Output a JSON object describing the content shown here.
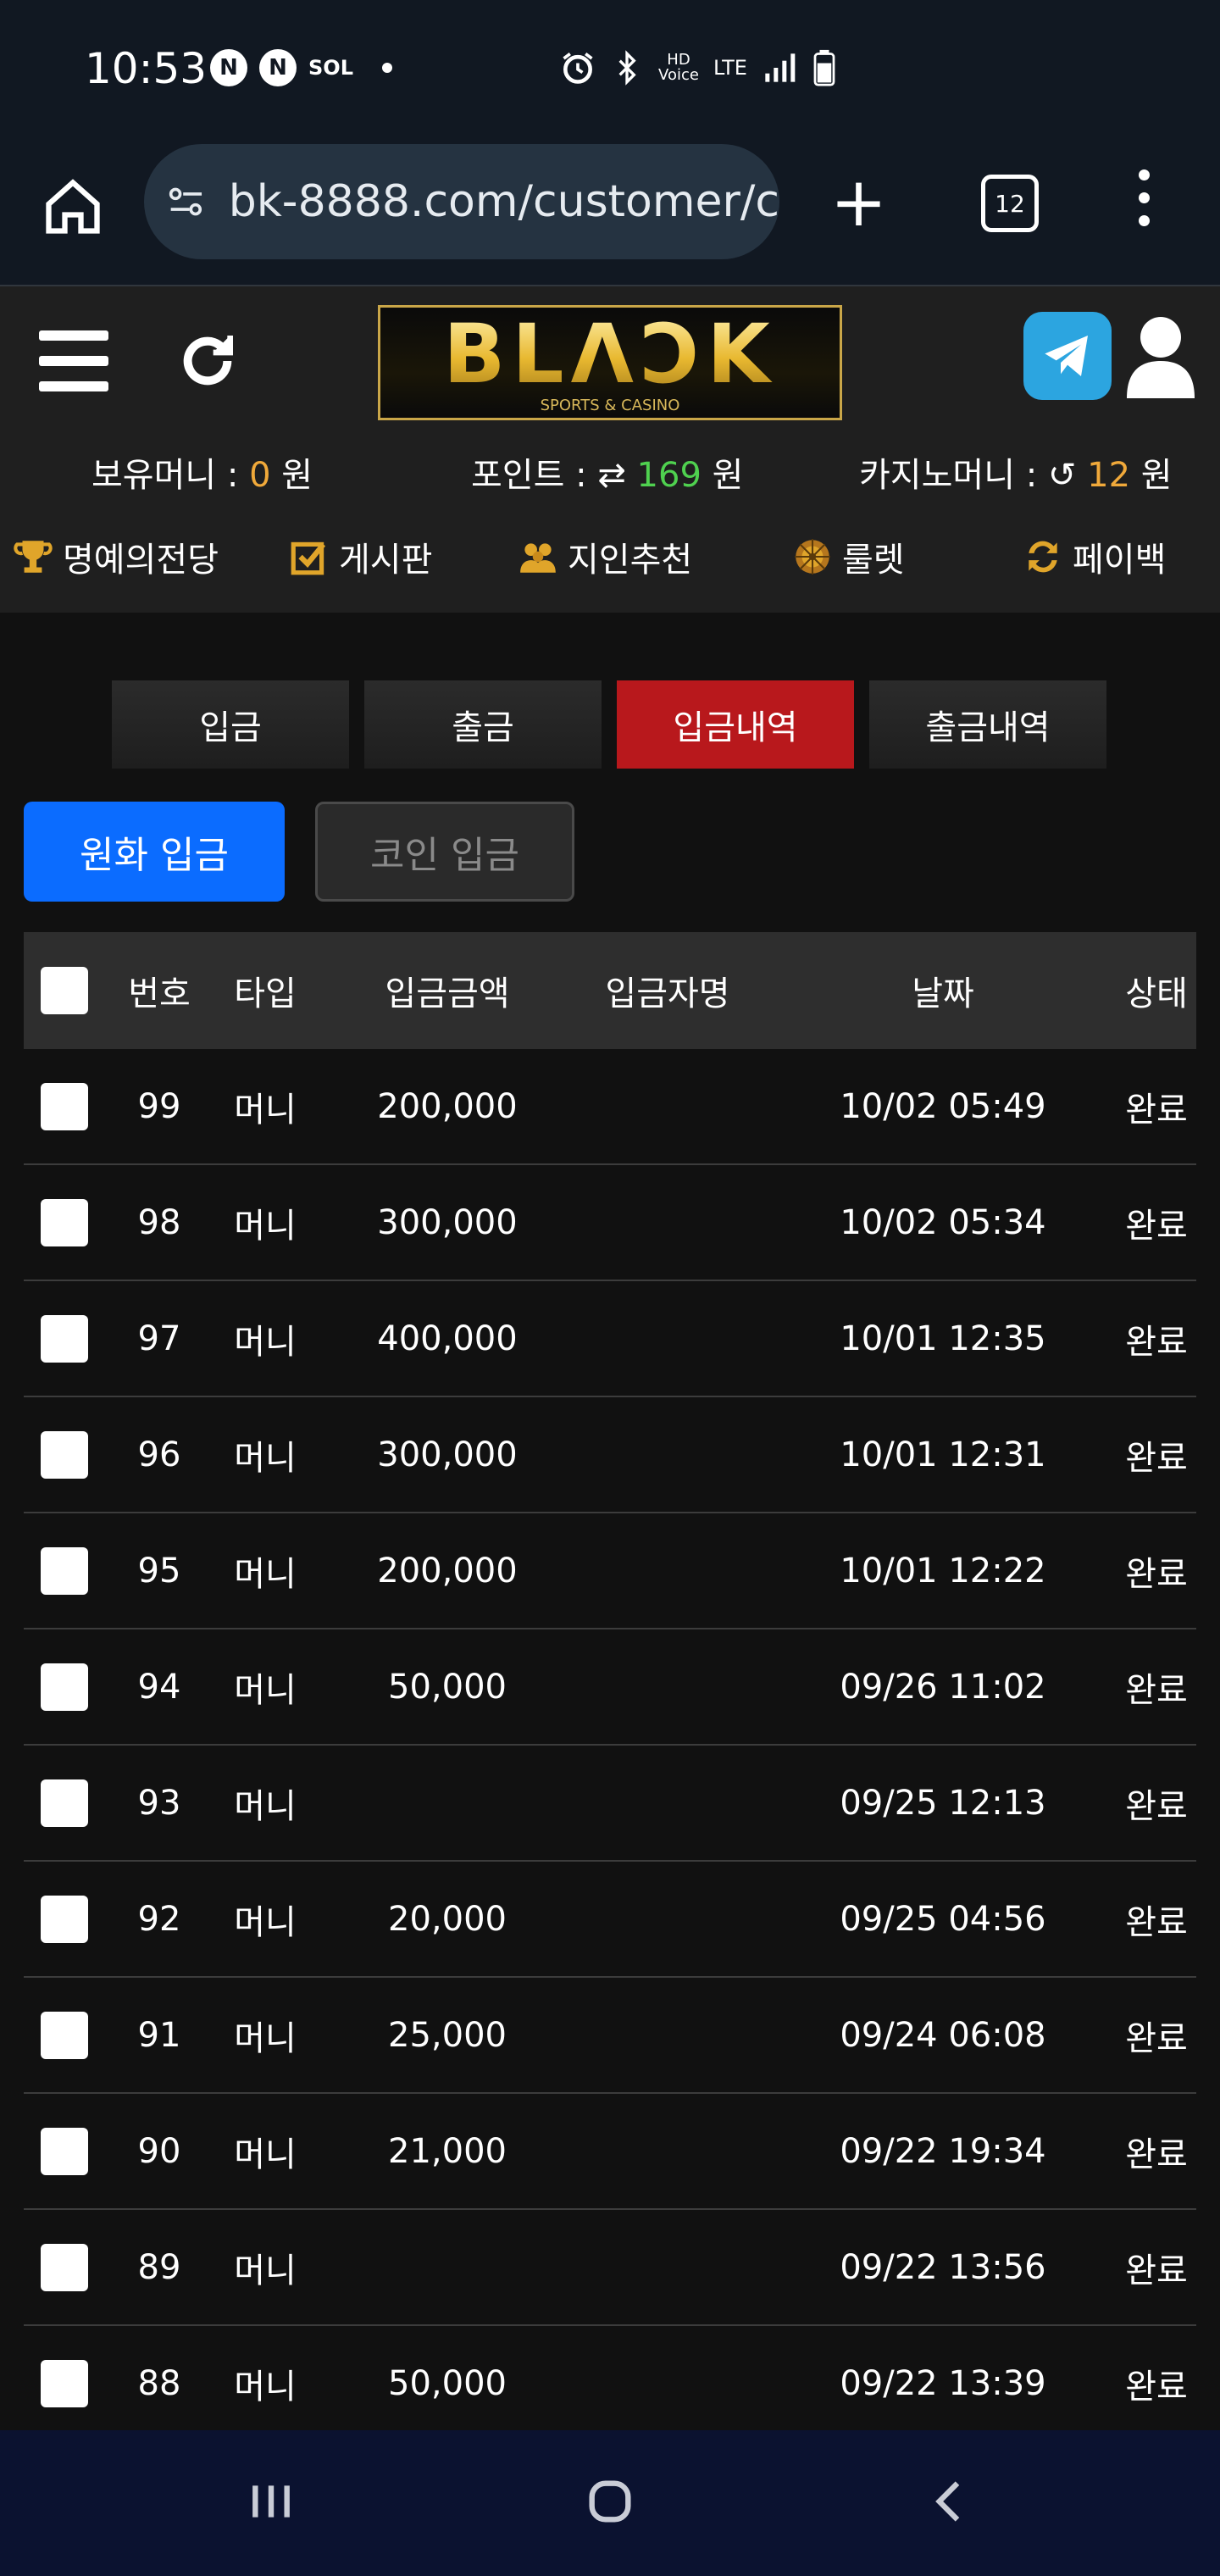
{
  "status_bar": {
    "time": "10:53",
    "left_icons": [
      "N",
      "N",
      "SOL"
    ],
    "right_icons": [
      "alarm-icon",
      "bluetooth-icon",
      "hd-voice-icon",
      "lte-icon",
      "signal-icon",
      "battery-icon"
    ],
    "hd_label": "HD Voice",
    "lte_label": "LTE"
  },
  "browser": {
    "url": "bk-8888.com/customer/c",
    "tab_count": "12"
  },
  "header": {
    "logo_text": "BLΛƆK",
    "logo_sub": "SPORTS & CASINO"
  },
  "balances": {
    "money_label": "보유머니 :",
    "money_value": "0",
    "money_unit": "원",
    "point_label": "포인트 :",
    "point_value": "169",
    "point_unit": "원",
    "casino_label": "카지노머니 :",
    "casino_value": "12",
    "casino_unit": "원"
  },
  "nav": [
    {
      "label": "명예의전당",
      "icon": "trophy-icon"
    },
    {
      "label": "게시판",
      "icon": "checkbox-icon"
    },
    {
      "label": "지인추천",
      "icon": "people-icon"
    },
    {
      "label": "룰렛",
      "icon": "roulette-icon"
    },
    {
      "label": "페이백",
      "icon": "cycle-icon"
    }
  ],
  "tabs": [
    "입금",
    "출금",
    "입금내역",
    "출금내역"
  ],
  "active_tab": "입금내역",
  "subtabs": [
    "원화 입금",
    "코인 입금"
  ],
  "table": {
    "headers": [
      "번호",
      "타입",
      "입금금액",
      "입금자명",
      "날짜",
      "상태"
    ],
    "rows": [
      {
        "no": "99",
        "type": "머니",
        "amount": "200,000",
        "name": "",
        "date": "10/02 05:49",
        "status": "완료"
      },
      {
        "no": "98",
        "type": "머니",
        "amount": "300,000",
        "name": "",
        "date": "10/02 05:34",
        "status": "완료"
      },
      {
        "no": "97",
        "type": "머니",
        "amount": "400,000",
        "name": "",
        "date": "10/01 12:35",
        "status": "완료"
      },
      {
        "no": "96",
        "type": "머니",
        "amount": "300,000",
        "name": "",
        "date": "10/01 12:31",
        "status": "완료"
      },
      {
        "no": "95",
        "type": "머니",
        "amount": "200,000",
        "name": "",
        "date": "10/01 12:22",
        "status": "완료"
      },
      {
        "no": "94",
        "type": "머니",
        "amount": "50,000",
        "name": "",
        "date": "09/26 11:02",
        "status": "완료"
      },
      {
        "no": "93",
        "type": "머니",
        "amount": "",
        "name": "",
        "date": "09/25 12:13",
        "status": "완료"
      },
      {
        "no": "92",
        "type": "머니",
        "amount": "20,000",
        "name": "",
        "date": "09/25 04:56",
        "status": "완료"
      },
      {
        "no": "91",
        "type": "머니",
        "amount": "25,000",
        "name": "",
        "date": "09/24 06:08",
        "status": "완료"
      },
      {
        "no": "90",
        "type": "머니",
        "amount": "21,000",
        "name": "",
        "date": "09/22 19:34",
        "status": "완료"
      },
      {
        "no": "89",
        "type": "머니",
        "amount": "",
        "name": "",
        "date": "09/22 13:56",
        "status": "완료"
      },
      {
        "no": "88",
        "type": "머니",
        "amount": "50,000",
        "name": "",
        "date": "09/22 13:39",
        "status": "완료"
      }
    ]
  },
  "colors": {
    "accent_blue": "#0b6cff",
    "active_red": "#b8181c",
    "gold": "#f0a93a",
    "green": "#4fd14f",
    "telegram": "#2ca5e0"
  },
  "system_nav": [
    "recents-icon",
    "home-icon",
    "back-icon"
  ]
}
